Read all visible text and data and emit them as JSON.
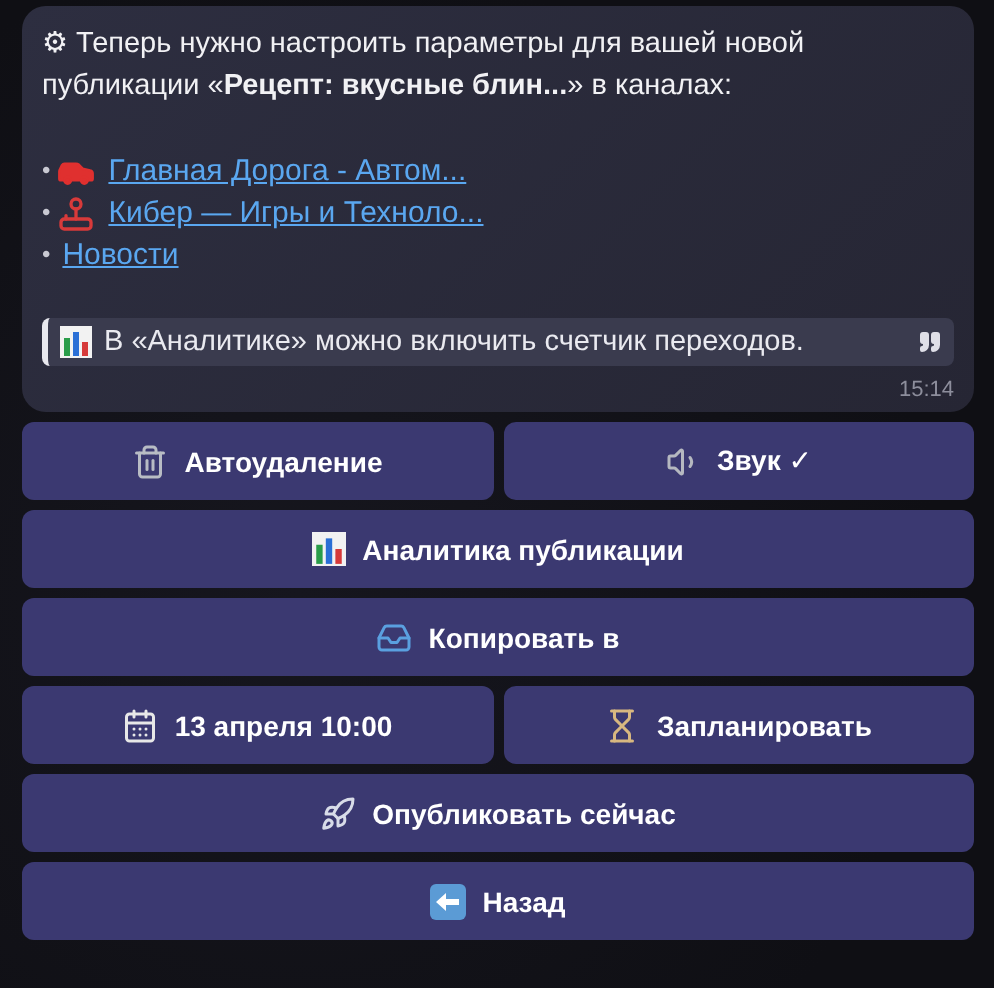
{
  "message": {
    "intro": "⚙ Теперь нужно настроить параметры для вашей новой публикации «**Рецепт: вкусные блин...**» в каналах:",
    "channels": [
      {
        "marker": "•",
        "kind": "car",
        "link": "Главная Дорога - Автом..."
      },
      {
        "marker": "•",
        "kind": "joystick",
        "link": "Кибер — Игры и Техноло..."
      },
      {
        "marker": "•",
        "kind": "plain",
        "link": "Новости"
      }
    ],
    "quote": "В «Аналитике» можно включить счетчик переходов.",
    "time": "15:14"
  },
  "keyboard": [
    [
      {
        "label": "Автоудаление",
        "kind": "trash"
      },
      {
        "label": "Звук ✓",
        "kind": "speaker"
      }
    ],
    [
      {
        "label": "Аналитика публикации",
        "kind": "chart"
      }
    ],
    [
      {
        "label": "Копировать в",
        "kind": "inbox"
      }
    ],
    [
      {
        "label": "13 апреля 10:00",
        "kind": "calendar"
      },
      {
        "label": "Запланировать",
        "kind": "hourglass"
      }
    ],
    [
      {
        "label": "Опубликовать сейчас",
        "kind": "rocket"
      }
    ],
    [
      {
        "label": "Назад",
        "kind": "back"
      }
    ]
  ]
}
